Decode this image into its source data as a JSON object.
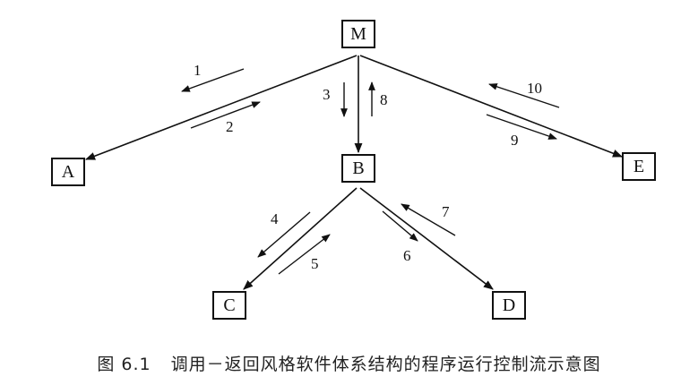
{
  "nodes": {
    "M": "M",
    "A": "A",
    "B": "B",
    "C": "C",
    "D": "D",
    "E": "E"
  },
  "steps": [
    "1",
    "2",
    "3",
    "4",
    "5",
    "6",
    "7",
    "8",
    "9",
    "10"
  ],
  "caption": {
    "figure": "图 6.1",
    "title": "调用－返回风格软件体系结构的程序运行控制流示意图"
  },
  "colors": {
    "stroke": "#111111",
    "text": "#222222",
    "background": "#ffffff"
  }
}
